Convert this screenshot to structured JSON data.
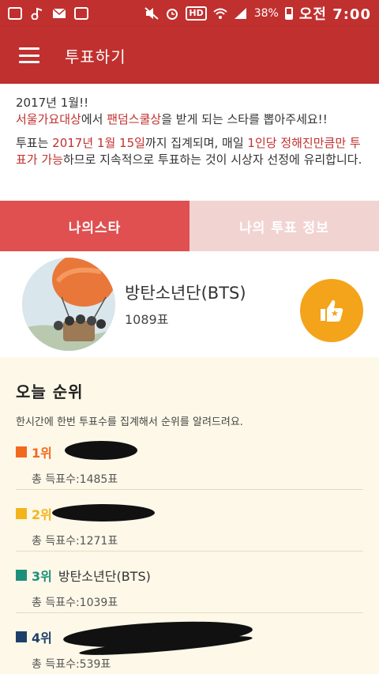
{
  "status_bar": {
    "battery": "38%",
    "hd": "HD",
    "time": "오전 7:00"
  },
  "app_bar": {
    "title": "투표하기"
  },
  "notice": {
    "line1": "2017년 1월!!",
    "line2_pre": "",
    "line2_hl1": "서울가요대상",
    "line2_mid": "에서 ",
    "line2_hl2": "팬덤스쿨상",
    "line2_post": "을 받게 되는 스타를 뽑아주세요!!",
    "p2_pre": "투표는 ",
    "p2_hl1": "2017년 1월 15일",
    "p2_mid1": "까지 집계되며, 매일 ",
    "p2_hl2": "1인당 정해진만큼만 투표가 가능",
    "p2_post": "하므로 지속적으로 투표하는 것이 시상자 선정에 유리합니다."
  },
  "tabs": [
    {
      "label": "나의스타",
      "active": true
    },
    {
      "label": "나의 투표 정보",
      "active": false
    }
  ],
  "my_star": {
    "name": "방탄소년단(BTS)",
    "votes": "1089표",
    "like_icon": "thumbs-up-star-icon"
  },
  "ranking": {
    "title": "오늘 순위",
    "description": "한시간에 한번 투표수를 집계해서 순위를 알려드려요.",
    "items": [
      {
        "rank": "1위",
        "name": "",
        "total": "총 득표수:1485표",
        "color": "#f06a1e"
      },
      {
        "rank": "2위",
        "name": "",
        "total": "총 득표수:1271표",
        "color": "#f3b41b"
      },
      {
        "rank": "3위",
        "name": "방탄소년단(BTS)",
        "total": "총 득표수:1039표",
        "color": "#1e8f7a"
      },
      {
        "rank": "4위",
        "name": "",
        "total": "총 득표수:539표",
        "color": "#1e3f6a"
      }
    ]
  },
  "colors": {
    "primary": "#c0302e",
    "tab_active": "#e05050",
    "tab_inactive": "#f1d4d2",
    "like_button": "#f3a41b",
    "ranking_bg": "#fdf8e8"
  }
}
